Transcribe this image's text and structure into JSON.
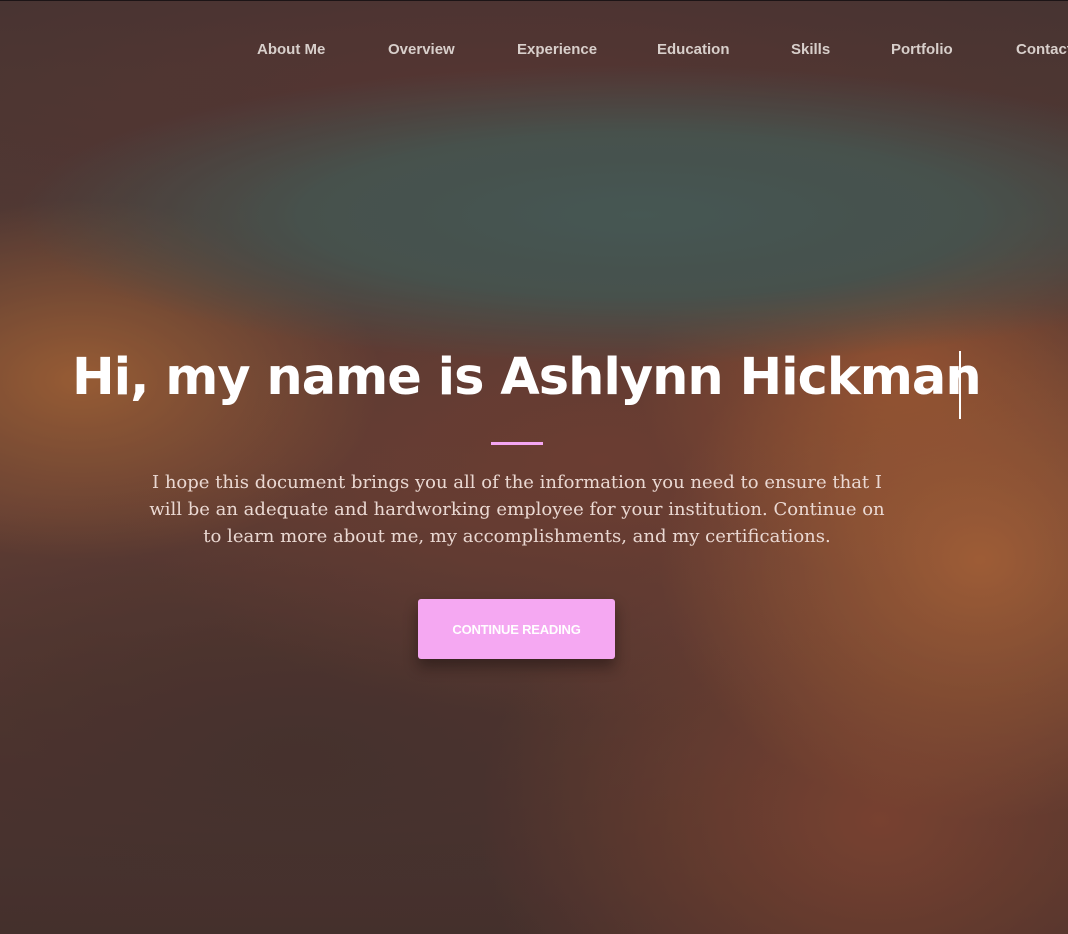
{
  "nav": {
    "items": [
      {
        "label": "About Me"
      },
      {
        "label": "Overview"
      },
      {
        "label": "Experience"
      },
      {
        "label": "Education"
      },
      {
        "label": "Skills"
      },
      {
        "label": "Portfolio"
      },
      {
        "label": "Contact"
      }
    ]
  },
  "hero": {
    "headline": "Hi, my name is Ashlynn Hickman",
    "intro": "I hope this document brings you all of the information you need to ensure that I will be an adequate and hardworking employee for your institution. Continue on to learn more about me, my accomplishments, and my certifications.",
    "cta_label": "CONTINUE READING"
  },
  "colors": {
    "accent": "#f5a8f2",
    "divider": "#f4a6f2",
    "headline": "#ffffff",
    "nav_text": "#d8cfcb",
    "intro_text": "#ead8d2"
  }
}
